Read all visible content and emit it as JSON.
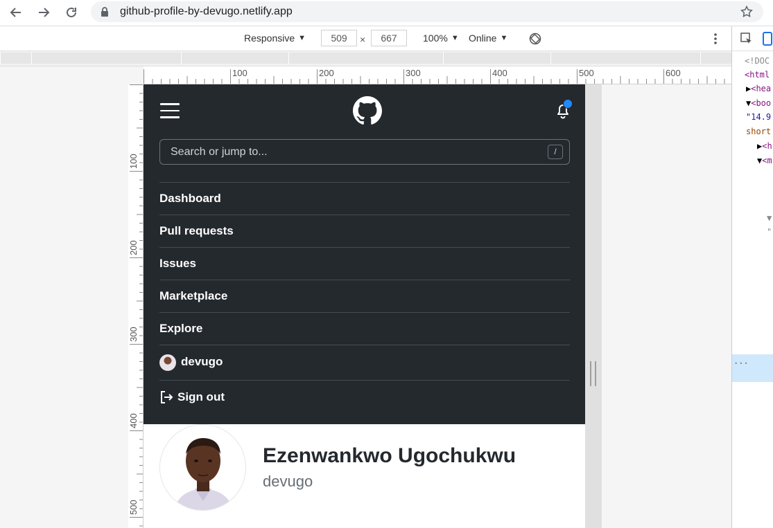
{
  "browser": {
    "url": "github-profile-by-devugo.netlify.app"
  },
  "device_toolbar": {
    "device": "Responsive",
    "width": "509",
    "height": "667",
    "times": "×",
    "zoom": "100%",
    "throttle": "Online"
  },
  "ruler": {
    "top_labels": [
      "100",
      "200",
      "300",
      "400",
      "500",
      "600"
    ],
    "left_labels": [
      "100",
      "200",
      "300",
      "400",
      "500"
    ]
  },
  "devtools": {
    "lines": [
      "<!DOC",
      "<html",
      "<hea",
      "<boo",
      "\"14.9",
      "short",
      "<h",
      "<m",
      "\"",
      "..."
    ]
  },
  "header": {
    "search_placeholder": "Search or jump to...",
    "search_shortcut": "/",
    "menu": [
      "Dashboard",
      "Pull requests",
      "Issues",
      "Marketplace",
      "Explore"
    ],
    "username": "devugo",
    "signout": "Sign out"
  },
  "profile": {
    "name": "Ezenwankwo Ugochukwu",
    "login": "devugo"
  },
  "colors": {
    "header_bg": "#24292e",
    "notification_dot": "#2188ff",
    "devtools_highlight": "#cfe8fc"
  }
}
